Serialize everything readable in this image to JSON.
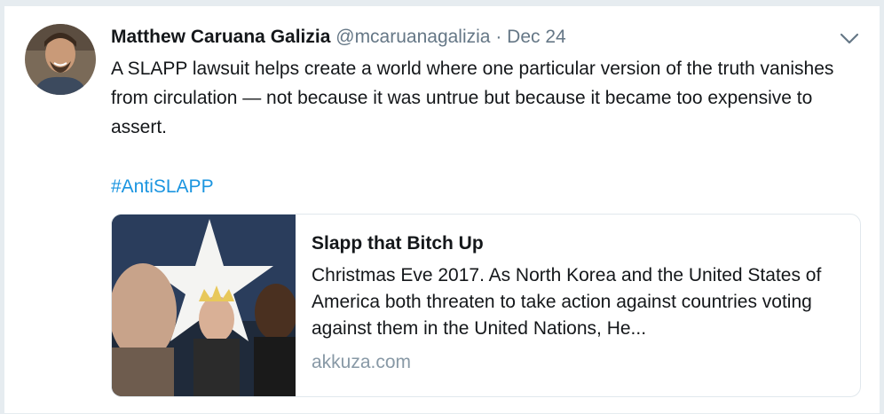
{
  "tweet": {
    "author_name": "Matthew Caruana Galizia",
    "handle": "@mcaruanagalizia",
    "separator": "·",
    "date": "Dec 24",
    "text": "A SLAPP lawsuit helps create a world where one particular version of the truth vanishes from circulation — not because it was untrue but because it became too expensive to assert.",
    "hashtag": "#AntiSLAPP",
    "menu_icon": "chevron-down-icon",
    "avatar_icon": "avatar"
  },
  "card": {
    "title": "Slapp that Bitch Up",
    "description": "Christmas Eve 2017. As North Korea and the United States of America both threaten to take action against countries voting against them in the United Nations, He...",
    "domain": "akkuza.com"
  },
  "colors": {
    "link": "#1b95e0",
    "secondary_text": "#657786",
    "domain_text": "#8899a6",
    "primary_text": "#14171a",
    "background": "#e6ecf0"
  }
}
